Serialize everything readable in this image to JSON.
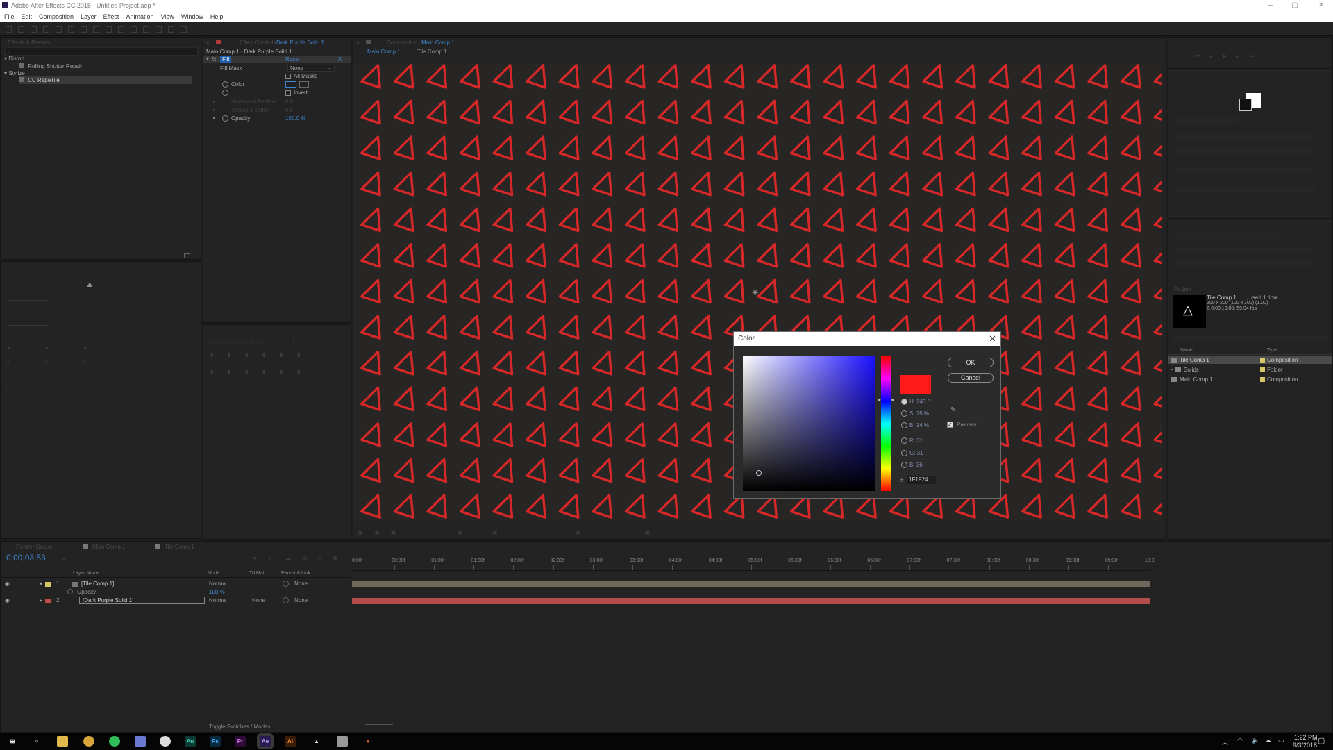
{
  "window": {
    "title": "Adobe After Effects CC 2018 - Untitled Project.aep *",
    "controls": [
      "–",
      "▢",
      "✕"
    ]
  },
  "menu": [
    "File",
    "Edit",
    "Composition",
    "Layer",
    "Effect",
    "Animation",
    "View",
    "Window",
    "Help"
  ],
  "effects_presets": {
    "tab": "Effects & Presets",
    "tree": [
      {
        "label": "Distort",
        "level": 0
      },
      {
        "label": "Rolling Shutter Repair",
        "level": 1
      },
      {
        "label": "Stylize",
        "level": 0
      },
      {
        "label": "CC RepeTile",
        "level": 1,
        "selected": true
      }
    ]
  },
  "effect_controls": {
    "tab": "Effect Controls",
    "layer": "Dark Purple Solid 1",
    "header": "Main Comp 1 · Dark Purple Solid 1",
    "effect": "Fill",
    "reset": "Reset",
    "rows": {
      "fill_mask": "Fill Mask",
      "fill_mask_value": "None",
      "all_masks": "All Masks",
      "color": "Color",
      "invert": "Invert",
      "h_feather": "Horizontal Feather",
      "h_feather_value": "0.0",
      "v_feather": "Vertical Feather",
      "v_feather_value": "0.0",
      "opacity": "Opacity",
      "opacity_value": "100.0 %"
    }
  },
  "composition": {
    "tab_prefix": "Composition",
    "tab": "Main Comp 1",
    "breadcrumb": [
      "Main Comp 1",
      "Tile Comp 1"
    ]
  },
  "color_dialog": {
    "title": "Color",
    "ok": "OK",
    "cancel": "Cancel",
    "h": "H: 243 °",
    "s": "S: 15 %",
    "b": "B: 14 %",
    "r": "R: 31",
    "g": "G: 31",
    "bl": "B: 36",
    "hex_label": "#",
    "hex": "1F1F24",
    "preview": "Preview",
    "preview_checked": true,
    "new_color": "#ff1a1a"
  },
  "project": {
    "tab": "Project",
    "selected_name": "Tile Comp 1",
    "used": ", used 1 time",
    "dims": "200 x 200 (100 x 100) (1.00)",
    "duration": "Δ 0;00;10;00, 59.94 fps",
    "columns": [
      "Name",
      "Type"
    ],
    "items": [
      {
        "name": "Tile Comp 1",
        "type": "Composition",
        "color": "#d8c66a"
      },
      {
        "name": "Solids",
        "type": "Folder",
        "color": "#d8c66a"
      },
      {
        "name": "Main Comp 1",
        "type": "Composition",
        "color": "#d8c66a"
      }
    ]
  },
  "timeline": {
    "tabs": [
      "Render Queue",
      "Main Comp 1",
      "Tile Comp 1"
    ],
    "timecode": "0;00;03;53",
    "columns": {
      "layer_name": "Layer Name",
      "mode": "Mode",
      "trkmat": "TrkMat",
      "parent": "Parent & Link"
    },
    "layers": [
      {
        "num": "1",
        "name": "[Tile Comp 1]",
        "mode": "Norma",
        "parent": "None",
        "color": "#d8c66a"
      },
      {
        "num": "2",
        "name": "[Dark Purple Solid 1]",
        "mode": "Norma",
        "trkmat": "None",
        "parent": "None",
        "color": "#c04c4c"
      }
    ],
    "opacity_label": "Opacity",
    "opacity_value": "100 %",
    "ruler": [
      "0:00f",
      "00:30f",
      "01:00f",
      "01:30f",
      "02:00f",
      "02:30f",
      "03:00f",
      "03:30f",
      "04:00f",
      "04:30f",
      "05:00f",
      "05:30f",
      "06:00f",
      "06:30f",
      "07:00f",
      "07:30f",
      "08:00f",
      "08:30f",
      "09:00f",
      "09:30f",
      "10:0"
    ],
    "playhead_fraction": 0.39,
    "toggle": "Toggle Switches / Modes"
  },
  "taskbar": {
    "time": "1:22 PM",
    "date": "9/3/2018",
    "apps": [
      "windows-icon",
      "cortana-icon",
      "file-explorer-icon",
      "chrome-icon",
      "spotify-icon",
      "discord-icon",
      "steam-icon",
      "audition-icon",
      "photoshop-icon",
      "premiere-icon",
      "after-effects-icon",
      "illustrator-icon",
      "app-icon",
      "app-icon",
      "app-icon"
    ]
  },
  "colors": {
    "triangle": "#d62828",
    "viewer_bg": "#282624",
    "accent_blue": "#2d8ceb"
  }
}
